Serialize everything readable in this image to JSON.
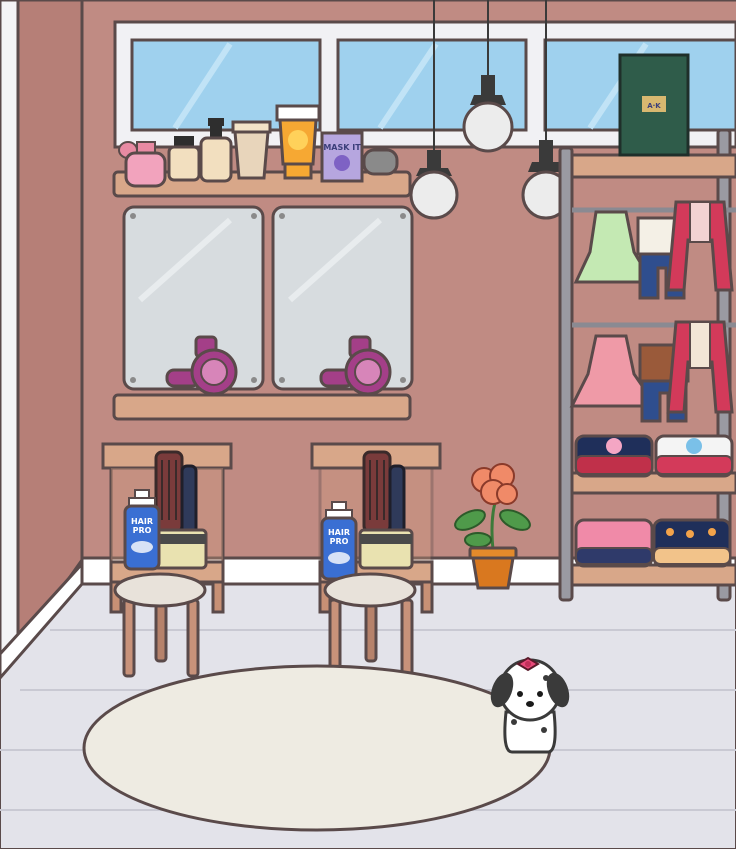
{
  "scene": {
    "room": "salon",
    "colors": {
      "wall": "#c08b83",
      "floor": "#e3e3ea",
      "window_sky": "#9fd1ee",
      "shelf_wood": "#d8a789",
      "dryer": "#a43f88",
      "rug": "#eeebe2",
      "outline": "#5a4a4a"
    }
  },
  "products": {
    "mask_label": "MASK IT",
    "hair_spray_label_line1": "HAIR",
    "hair_spray_label_line2": "PRO",
    "box_label": "A·K"
  },
  "icons": [
    "hair-dryer-icon",
    "brush-icon",
    "comb-icon",
    "plant-icon",
    "dog-icon",
    "lamp-icon",
    "clothes-rack-icon"
  ]
}
